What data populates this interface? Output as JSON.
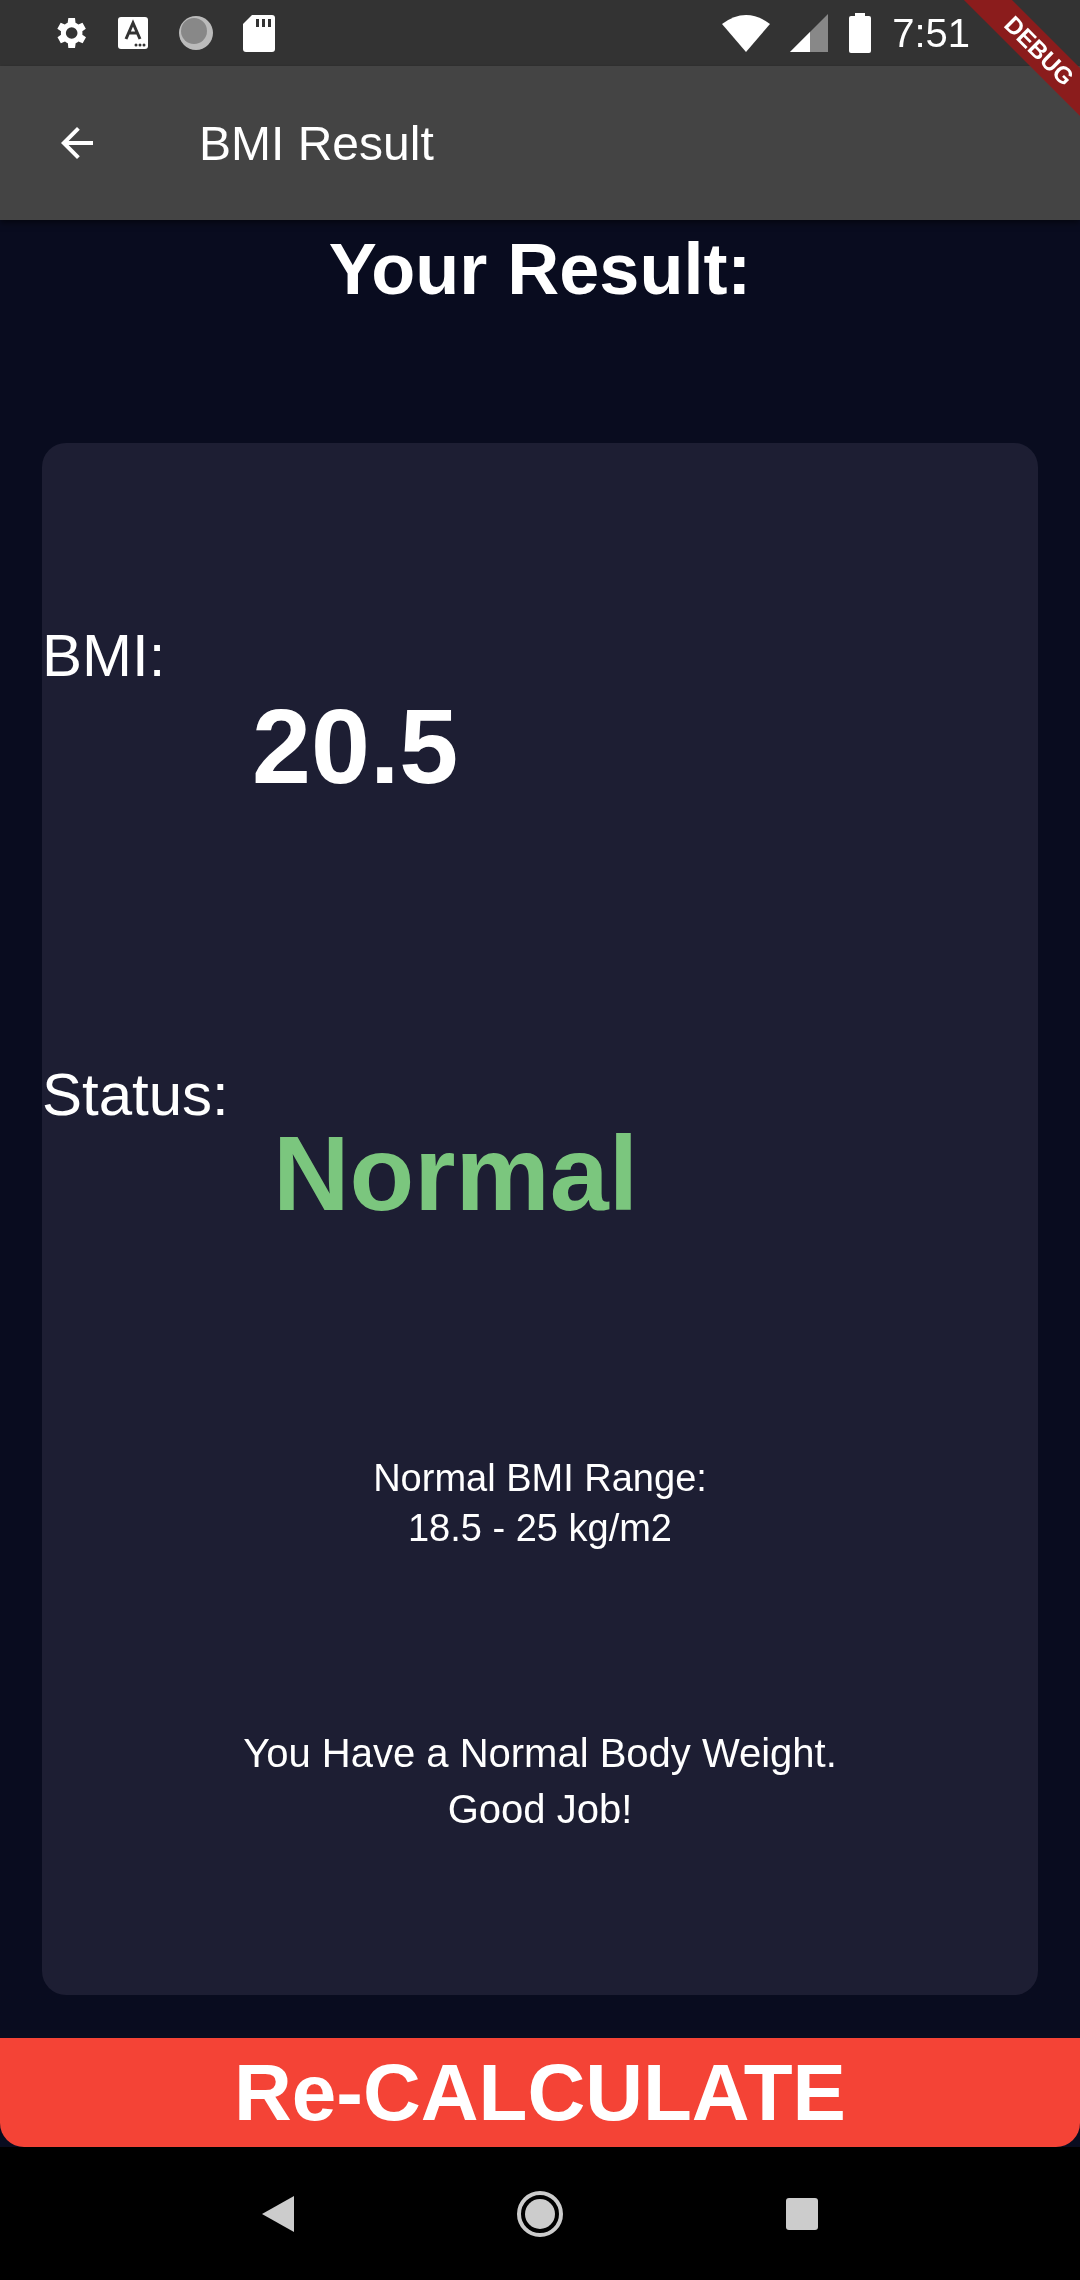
{
  "status_bar": {
    "time": "7:51"
  },
  "debug_banner": "DEBUG",
  "app_bar": {
    "title": "BMI Result"
  },
  "heading": "Your Result:",
  "result_card": {
    "bmi_label": "BMI:",
    "bmi_value": "20.5",
    "status_label": "Status:",
    "status_value": "Normal",
    "range_lines": [
      "Normal BMI Range:",
      "18.5 - 25 kg/m2"
    ],
    "message_lines": [
      "You Have a Normal Body Weight.",
      "Good Job!"
    ]
  },
  "recalculate_button": "Re-CALCULATE"
}
